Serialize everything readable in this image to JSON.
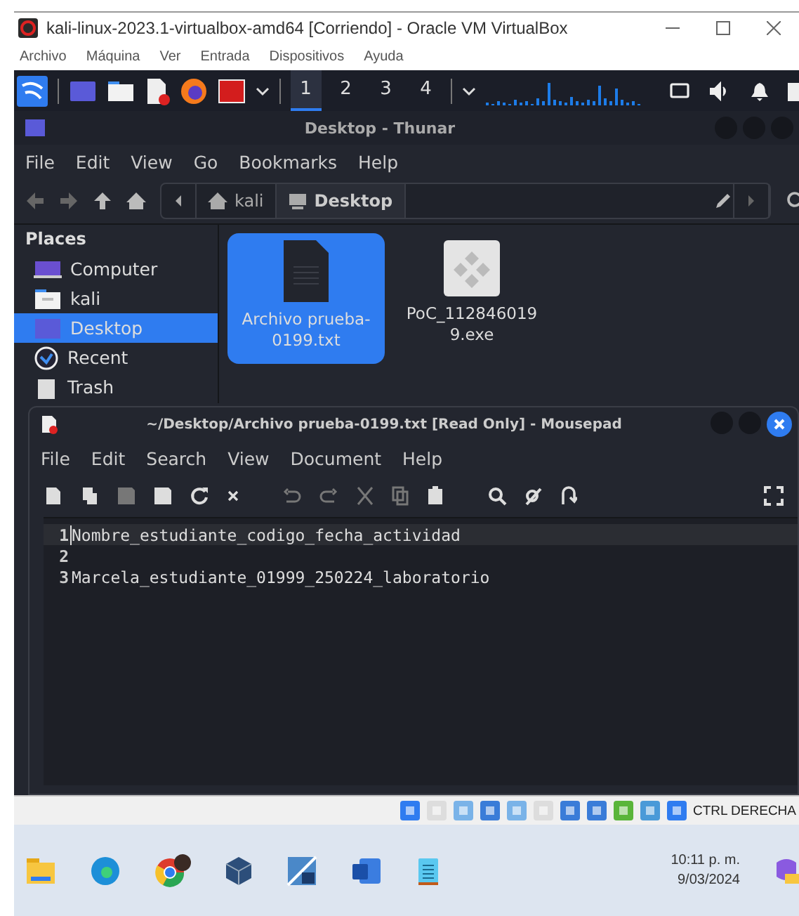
{
  "vbox_window": {
    "title": "kali-linux-2023.1-virtualbox-amd64 [Corriendo] - Oracle VM VirtualBox",
    "menu": [
      "Archivo",
      "Máquina",
      "Ver",
      "Entrada",
      "Dispositivos",
      "Ayuda"
    ]
  },
  "panel": {
    "workspaces": [
      {
        "label": "1",
        "selected": true
      },
      {
        "label": "2",
        "selected": false
      },
      {
        "label": "3",
        "selected": false
      },
      {
        "label": "4",
        "selected": false
      }
    ]
  },
  "thunar": {
    "title": "Desktop - Thunar",
    "menu": [
      "File",
      "Edit",
      "View",
      "Go",
      "Bookmarks",
      "Help"
    ],
    "path": [
      {
        "label": "kali",
        "kind": "home",
        "selected": false
      },
      {
        "label": "Desktop",
        "kind": "desktop",
        "selected": true
      }
    ],
    "places_heading": "Places",
    "places": [
      {
        "label": "Computer",
        "kind": "computer",
        "selected": false
      },
      {
        "label": "kali",
        "kind": "folder",
        "selected": false
      },
      {
        "label": "Desktop",
        "kind": "desktop",
        "selected": true
      },
      {
        "label": "Recent",
        "kind": "recent",
        "selected": false
      },
      {
        "label": "Trash",
        "kind": "trash",
        "selected": false
      }
    ],
    "files": [
      {
        "name": "Archivo prueba-0199.txt",
        "kind": "text",
        "selected": true
      },
      {
        "name": "PoC_1128460199.exe",
        "kind": "exe",
        "selected": false
      }
    ]
  },
  "mousepad": {
    "title": "~/Desktop/Archivo prueba-0199.txt [Read Only] - Mousepad",
    "menu": [
      "File",
      "Edit",
      "Search",
      "View",
      "Document",
      "Help"
    ],
    "lines": [
      {
        "number": "1",
        "text": "Nombre_estudiante_codigo_fecha_actividad",
        "current": true
      },
      {
        "number": "2",
        "current": false
      },
      {
        "number": "3",
        "text": "Marcela_estudiante_01999_250224_laboratorio",
        "current": false
      }
    ]
  },
  "status_bar": {
    "host_key": "CTRL DERECHA"
  },
  "taskbar": {
    "time": "10:11 p. m.",
    "date": "9/03/2024"
  }
}
